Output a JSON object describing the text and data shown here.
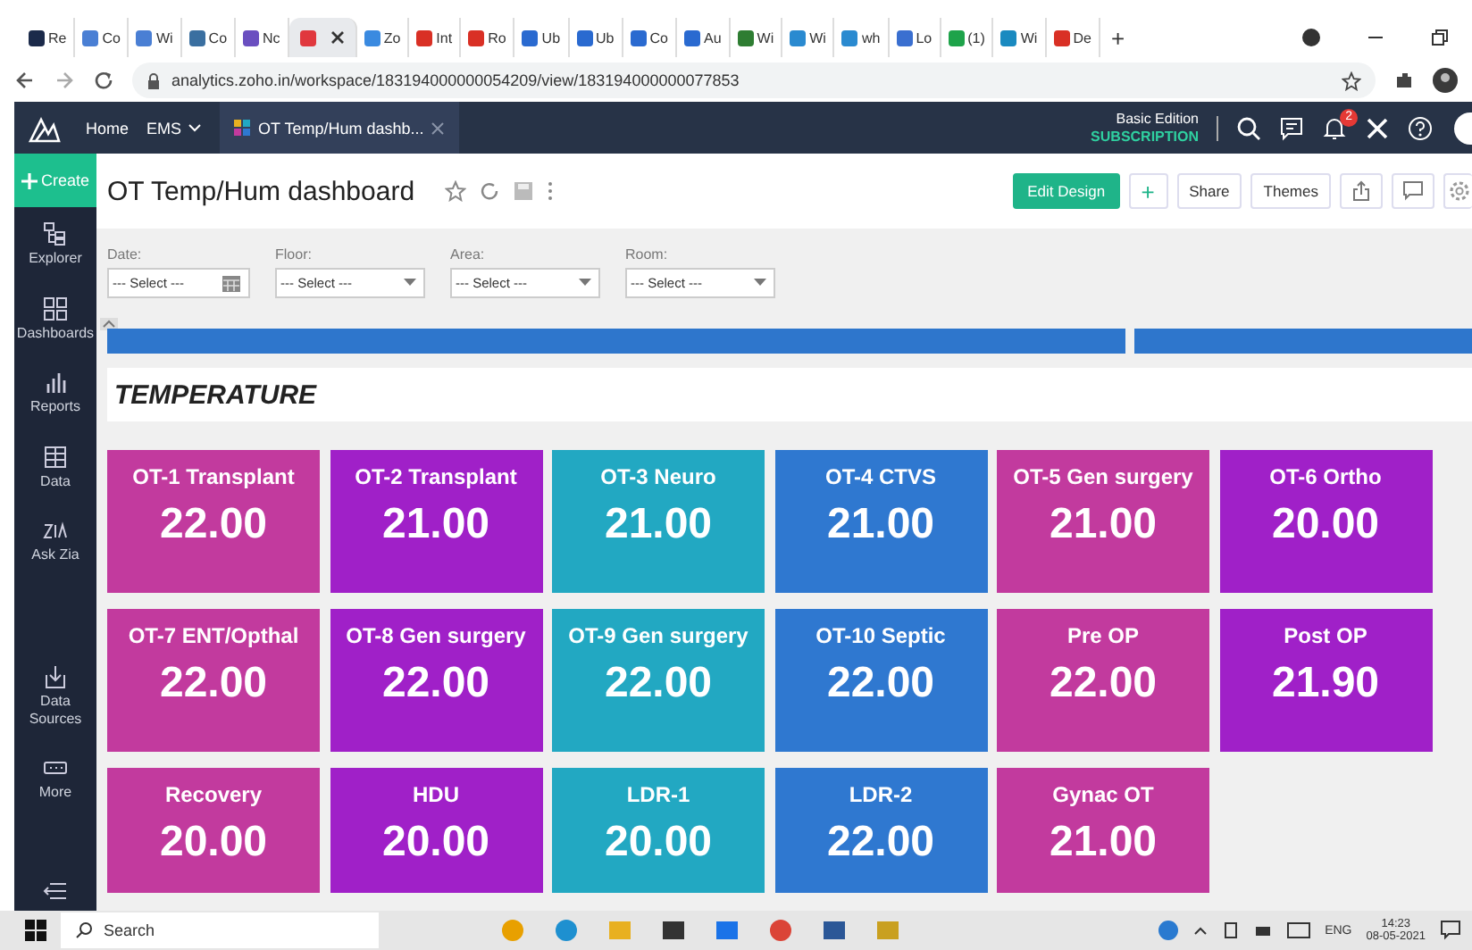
{
  "browser": {
    "tabs": [
      {
        "label": "Re",
        "color": "#1b2a4a",
        "selected": false
      },
      {
        "label": "Co",
        "color": "#4a7fd4",
        "selected": false
      },
      {
        "label": "Wi",
        "color": "#4a7fd4",
        "selected": false
      },
      {
        "label": "Co",
        "color": "#3a6fa0",
        "selected": false
      },
      {
        "label": "Nc",
        "color": "#6a4fc0",
        "selected": false
      },
      {
        "color": "#e0383e",
        "selected": true
      },
      {
        "label": "Zo",
        "color": "#3a8ae0",
        "selected": false
      },
      {
        "label": "Int",
        "color": "#d93025",
        "selected": false
      },
      {
        "label": "Ro",
        "color": "#d93025",
        "selected": false
      },
      {
        "label": "Ub",
        "color": "#2a6ad0",
        "selected": false
      },
      {
        "label": "Ub",
        "color": "#2a6ad0",
        "selected": false
      },
      {
        "label": "Co",
        "color": "#2a6ad0",
        "selected": false
      },
      {
        "label": "Au",
        "color": "#2a6ad0",
        "selected": false
      },
      {
        "label": "Wi",
        "color": "#2e7d32",
        "selected": false
      },
      {
        "label": "Wi",
        "color": "#2a8ad0",
        "selected": false
      },
      {
        "label": "wh",
        "color": "#2a8ad0",
        "selected": false
      },
      {
        "label": "Lo",
        "color": "#3a6fd0",
        "selected": false
      },
      {
        "label": "(1)",
        "color": "#1ea34a",
        "selected": false
      },
      {
        "label": "Wi",
        "color": "#1a8ac0",
        "selected": false
      },
      {
        "label": "De",
        "color": "#d93025",
        "selected": false
      }
    ],
    "new_tab": "+",
    "address": "analytics.zoho.in/workspace/183194000000054209/view/183194000000077853"
  },
  "app_header": {
    "nav": [
      "Home",
      "EMS"
    ],
    "tab": "OT Temp/Hum dashb...",
    "edition": "Basic Edition",
    "subscription": "SUBSCRIPTION",
    "notification_count": "2"
  },
  "sidebar": {
    "create": "Create",
    "items": [
      {
        "label": "Explorer",
        "kind": "explorer"
      },
      {
        "label": "Dashboards",
        "kind": "dashboards"
      },
      {
        "label": "Reports",
        "kind": "reports"
      },
      {
        "label": "Data",
        "kind": "data"
      },
      {
        "label": "Ask Zia",
        "kind": "zia"
      },
      {
        "label": "Data Sources",
        "kind": "sources"
      },
      {
        "label": "More",
        "kind": "more"
      }
    ]
  },
  "dashboard": {
    "title": "OT Temp/Hum dashboard",
    "buttons": [
      "Edit Design",
      "+",
      "Share",
      "Themes"
    ],
    "filters": [
      {
        "label": "Date:",
        "value": "--- Select ---",
        "kind": "date"
      },
      {
        "label": "Floor:",
        "value": "--- Select ---",
        "kind": "dropdown"
      },
      {
        "label": "Area:",
        "value": "--- Select ---",
        "kind": "dropdown"
      },
      {
        "label": "Room:",
        "value": "--- Select ---",
        "kind": "dropdown"
      }
    ],
    "section_title": "TEMPERATURE",
    "tiles": [
      {
        "name": "OT-1 Transplant",
        "value": "22.00",
        "color": "#c23a9e"
      },
      {
        "name": "OT-2 Transplant",
        "value": "21.00",
        "color": "#a020c8"
      },
      {
        "name": "OT-3 Neuro",
        "value": "21.00",
        "color": "#22a8c2"
      },
      {
        "name": "OT-4 CTVS",
        "value": "21.00",
        "color": "#2f78d0"
      },
      {
        "name": "OT-5 Gen surgery",
        "value": "21.00",
        "color": "#c23a9e"
      },
      {
        "name": "OT-6 Ortho",
        "value": "20.00",
        "color": "#a020c8"
      },
      {
        "name": "OT-7 ENT/Opthal",
        "value": "22.00",
        "color": "#c23a9e"
      },
      {
        "name": "OT-8 Gen surgery",
        "value": "22.00",
        "color": "#a020c8"
      },
      {
        "name": "OT-9 Gen surgery",
        "value": "22.00",
        "color": "#22a8c2"
      },
      {
        "name": "OT-10 Septic",
        "value": "22.00",
        "color": "#2f78d0"
      },
      {
        "name": "Pre OP",
        "value": "22.00",
        "color": "#c23a9e"
      },
      {
        "name": "Post OP",
        "value": "21.90",
        "color": "#a020c8"
      },
      {
        "name": "Recovery",
        "value": "20.00",
        "color": "#c23a9e"
      },
      {
        "name": "HDU",
        "value": "20.00",
        "color": "#a020c8"
      },
      {
        "name": "LDR-1",
        "value": "20.00",
        "color": "#22a8c2"
      },
      {
        "name": "LDR-2",
        "value": "22.00",
        "color": "#2f78d0"
      },
      {
        "name": "Gynac OT",
        "value": "21.00",
        "color": "#c23a9e"
      }
    ]
  },
  "taskbar": {
    "search_placeholder": "Search",
    "language": "ENG",
    "time": "14:23",
    "date": "08-05-2021"
  }
}
